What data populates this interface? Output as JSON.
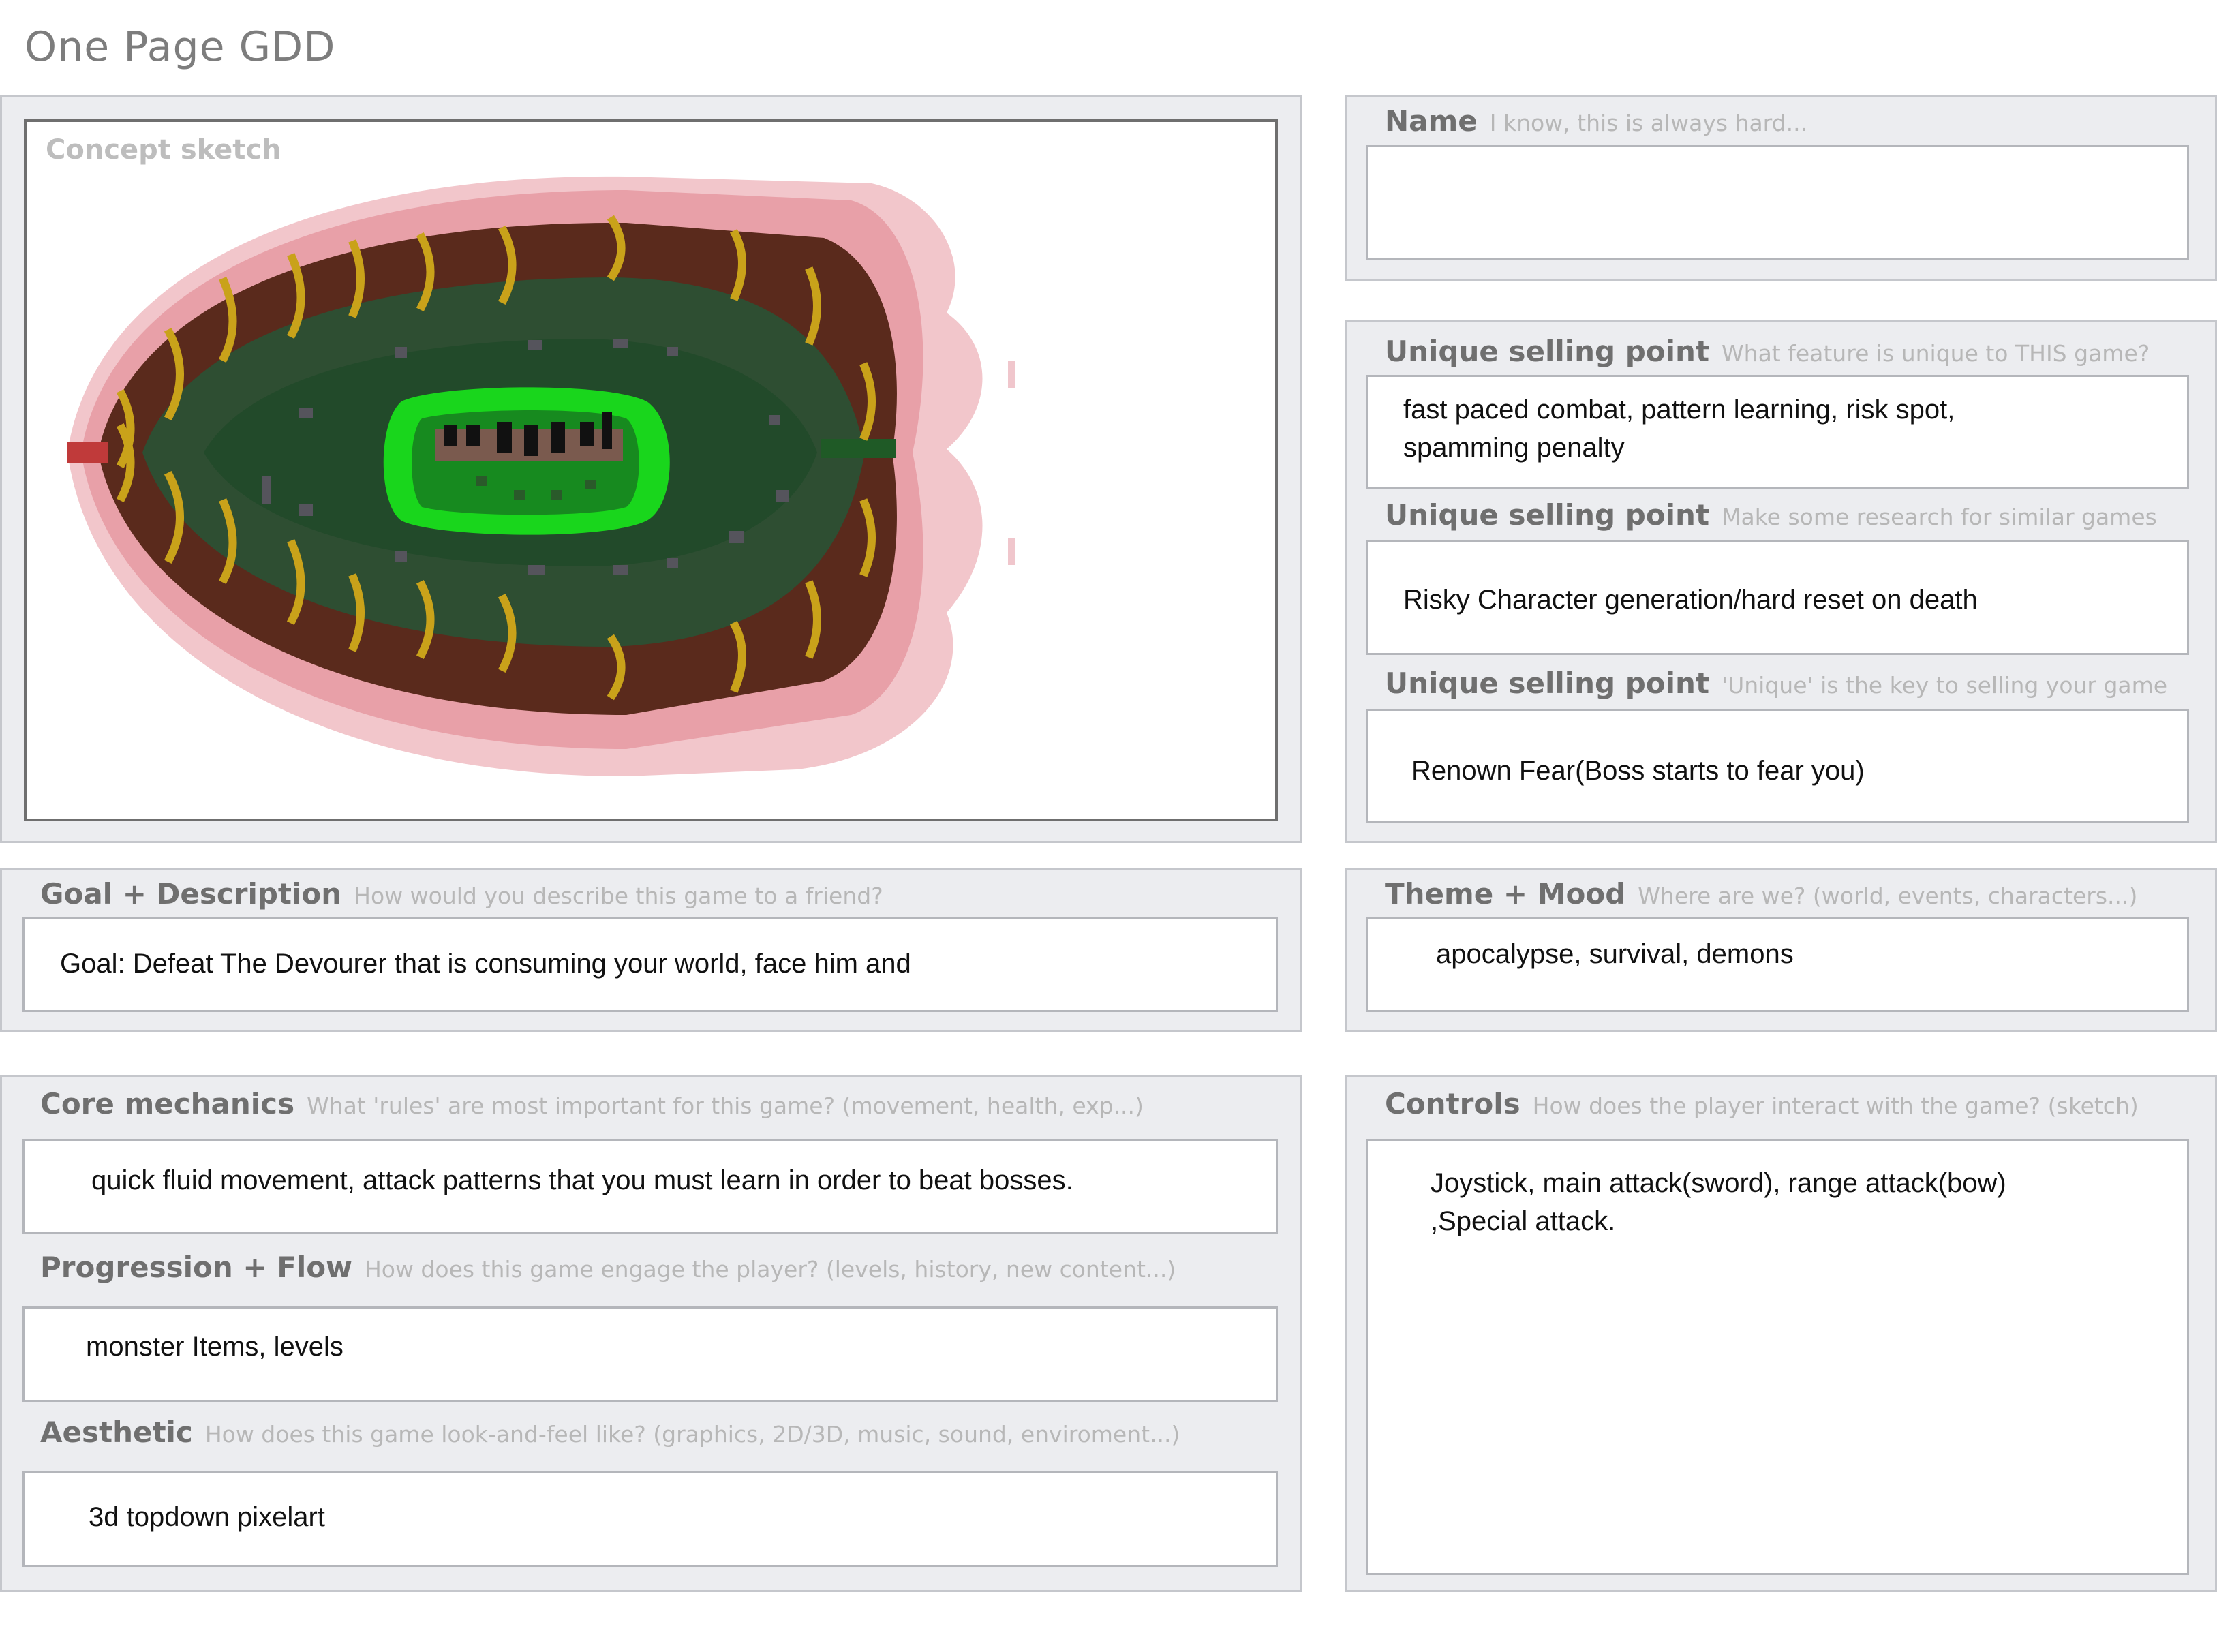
{
  "page": {
    "title": "One Page GDD"
  },
  "concept": {
    "label": "Concept sketch"
  },
  "name": {
    "title": "Name",
    "hint": "I know, this is always hard...",
    "value": ""
  },
  "usp": [
    {
      "title": "Unique selling point",
      "hint": "What feature is unique to THIS game?",
      "value": "fast paced combat, pattern learning,  risk spot,\nspamming penalty"
    },
    {
      "title": "Unique selling point",
      "hint": "Make some research for similar games",
      "value": "Risky Character generation/hard reset on death"
    },
    {
      "title": "Unique selling point",
      "hint": "'Unique' is the key to selling your game",
      "value": "Renown Fear(Boss starts to fear you)"
    }
  ],
  "goal": {
    "title": "Goal + Description",
    "hint": "How would you describe this game to a friend?",
    "value": "Goal: Defeat The Devourer that is consuming your world, face him and"
  },
  "theme": {
    "title": "Theme + Mood",
    "hint": "Where are we? (world, events, characters...)",
    "value": "apocalypse, survival, demons"
  },
  "core": {
    "title": "Core mechanics",
    "hint": "What 'rules' are most important for this game? (movement, health, exp...)",
    "value": "quick fluid movement, attack patterns that you must learn in order to beat bosses."
  },
  "progression": {
    "title": "Progression + Flow",
    "hint": "How does this game engage the player? (levels, history, new content...)",
    "value": "monster Items, levels"
  },
  "aesthetic": {
    "title": "Aesthetic",
    "hint": "How does this game look-and-feel like? (graphics, 2D/3D, music, sound, enviroment...)",
    "value": "3d topdown pixelart"
  },
  "controls": {
    "title": "Controls",
    "hint": "How does the player interact with the game? (sketch)",
    "value": "Joystick, main attack(sword), range attack(bow)\n,Special attack."
  },
  "colors": {
    "panel_bg": "#ecedf0",
    "panel_border": "#c5c7cc",
    "arena_glow": "#e8a0a8",
    "arena_wall": "#5a2a1c",
    "arena_floor": "#2e4e32",
    "arena_center": "#1f5a26",
    "platform_green": "#19d61c",
    "rune_gold": "#c9a21a"
  }
}
